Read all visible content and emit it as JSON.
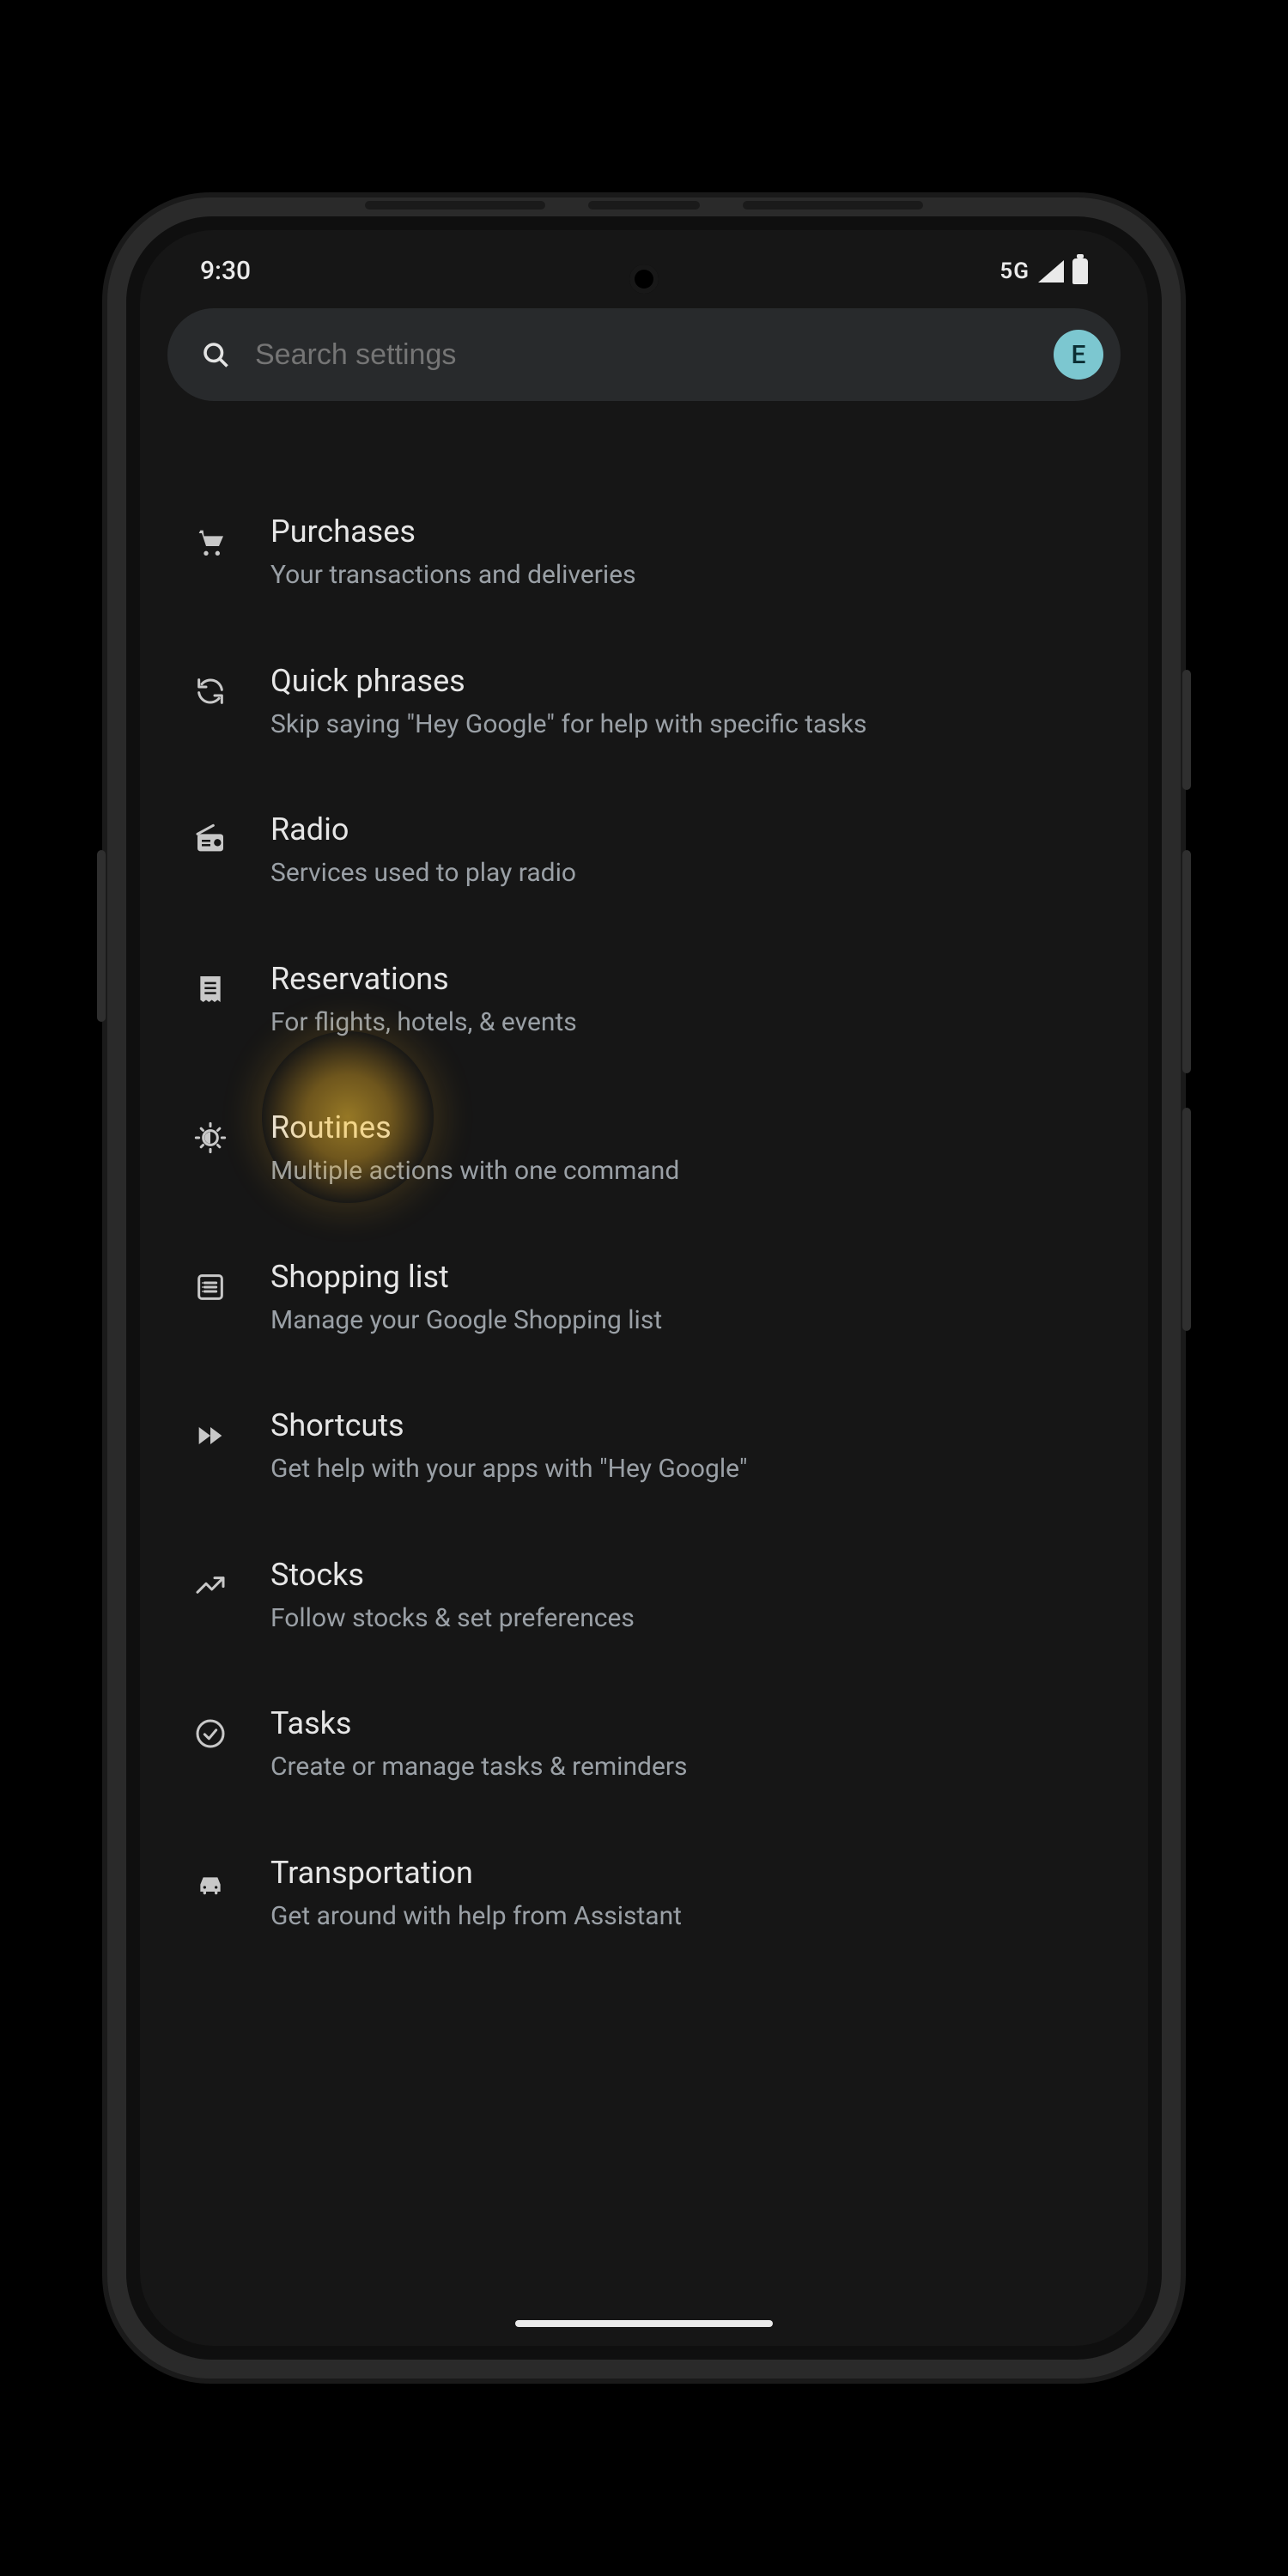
{
  "status": {
    "time": "9:30",
    "network": "5G"
  },
  "search": {
    "placeholder": "Search settings",
    "avatar_initial": "E"
  },
  "highlight_index": 4,
  "items": [
    {
      "id": "purchases",
      "icon": "cart",
      "title": "Purchases",
      "subtitle": "Your transactions and deliveries"
    },
    {
      "id": "quick-phrases",
      "icon": "refresh",
      "title": "Quick phrases",
      "subtitle": "Skip saying \"Hey Google\" for help with specific tasks"
    },
    {
      "id": "radio",
      "icon": "radio",
      "title": "Radio",
      "subtitle": "Services used to play radio"
    },
    {
      "id": "reservations",
      "icon": "receipt",
      "title": "Reservations",
      "subtitle": "For flights, hotels, & events"
    },
    {
      "id": "routines",
      "icon": "sun-gear",
      "title": "Routines",
      "subtitle": "Multiple actions with one command"
    },
    {
      "id": "shopping-list",
      "icon": "list-box",
      "title": "Shopping list",
      "subtitle": "Manage your Google Shopping list"
    },
    {
      "id": "shortcuts",
      "icon": "fast-forward",
      "title": "Shortcuts",
      "subtitle": "Get help with your apps with \"Hey Google\""
    },
    {
      "id": "stocks",
      "icon": "trend-up",
      "title": "Stocks",
      "subtitle": "Follow stocks & set preferences"
    },
    {
      "id": "tasks",
      "icon": "check-circle",
      "title": "Tasks",
      "subtitle": "Create or manage tasks & reminders"
    },
    {
      "id": "transportation",
      "icon": "car",
      "title": "Transportation",
      "subtitle": "Get around with help from Assistant"
    }
  ]
}
